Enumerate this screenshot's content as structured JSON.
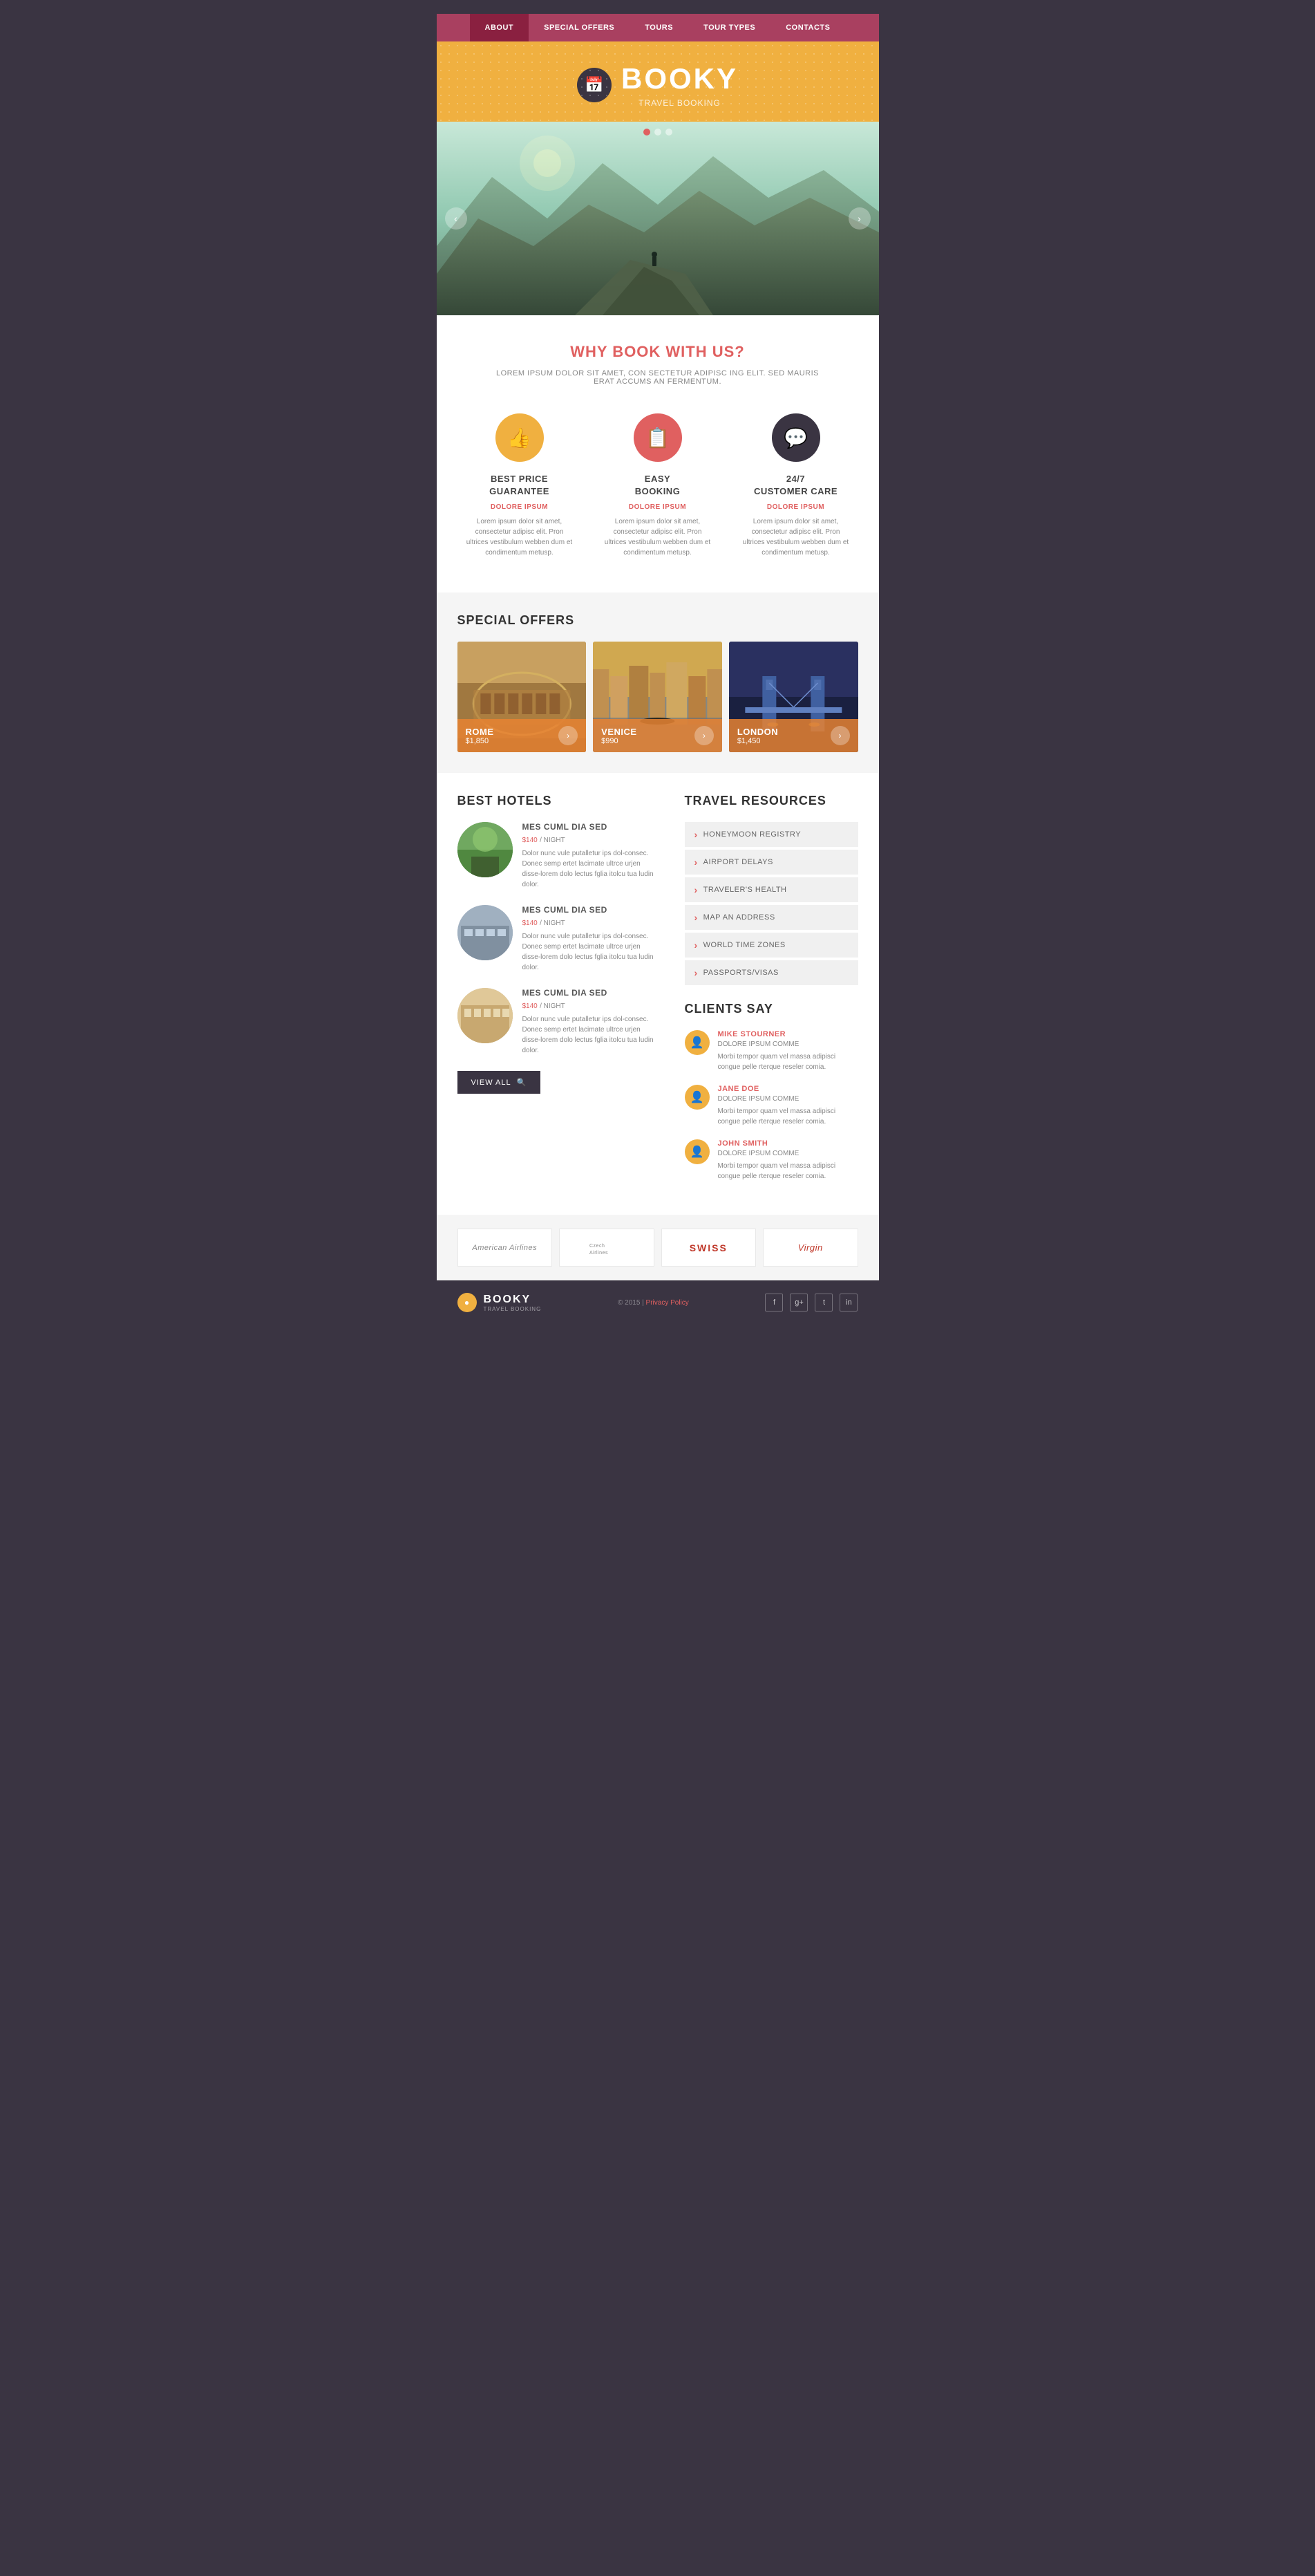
{
  "nav": {
    "items": [
      {
        "label": "ABOUT",
        "active": true
      },
      {
        "label": "SPECIAL OFFERS",
        "active": false
      },
      {
        "label": "TOURS",
        "active": false
      },
      {
        "label": "TOUR TYPES",
        "active": false
      },
      {
        "label": "CONTACTS",
        "active": false
      }
    ]
  },
  "header": {
    "icon": "📅",
    "title": "BOOKY",
    "subtitle": "TRAVEL BOOKING"
  },
  "hero": {
    "dots": [
      true,
      false,
      false
    ],
    "prev_arrow": "‹",
    "next_arrow": "›"
  },
  "why_book": {
    "title": "WHY BOOK WITH US?",
    "subtitle": "LOREM IPSUM DOLOR SIT AMET, CON SECTETUR ADIPISC ING ELIT. SED MAURIS ERAT ACCUMS AN FERMENTUM.",
    "features": [
      {
        "icon": "👍",
        "icon_class": "gold",
        "title": "BEST PRICE\nGUARANTEE",
        "subtitle": "DOLORE IPSUM",
        "desc": "Lorem ipsum dolor sit amet, consectetur adipisc elit. Pron ultrices vestibulum webben dum et condimentum metusp."
      },
      {
        "icon": "📋",
        "icon_class": "red",
        "title": "EASY\nBOOKING",
        "subtitle": "DOLORE IPSUM",
        "desc": "Lorem ipsum dolor sit amet, consectetur adipisc elit. Pron ultrices vestibulum webben dum et condimentum metusp."
      },
      {
        "icon": "💬",
        "icon_class": "dark",
        "title": "24/7\nCUSTOMER CARE",
        "subtitle": "DOLORE IPSUM",
        "desc": "Lorem ipsum dolor sit amet, consectetur adipisc elit. Pron ultrices vestibulum webben dum et condimentum metusp."
      }
    ]
  },
  "special_offers": {
    "section_title": "SPECIAL OFFERS",
    "offers": [
      {
        "name": "ROME",
        "price": "$1,850",
        "bg_class": "offer-rome-bg"
      },
      {
        "name": "VENICE",
        "price": "$990",
        "bg_class": "offer-venice-bg"
      },
      {
        "name": "LONDON",
        "price": "$1,450",
        "bg_class": "offer-london-bg"
      }
    ]
  },
  "best_hotels": {
    "section_title": "BEST HOTELS",
    "hotels": [
      {
        "name": "MES CUML DIA SED",
        "price": "$140",
        "price_suffix": "/ NIGHT",
        "desc": "Dolor nunc vule putalletur ips dol-consec. Donec semp ertet lacimate ultrce urjen disse-lorem dolo lectus fglia itolcu tua ludin dolor.",
        "img_class": "hotel-img-1"
      },
      {
        "name": "MES CUML DIA SED",
        "price": "$140",
        "price_suffix": "/ NIGHT",
        "desc": "Dolor nunc vule putalletur ips dol-consec. Donec semp ertet lacimate ultrce urjen disse-lorem dolo lectus fglia itolcu tua ludin dolor.",
        "img_class": "hotel-img-2"
      },
      {
        "name": "MES CUML DIA SED",
        "price": "$140",
        "price_suffix": "/ NIGHT",
        "desc": "Dolor nunc vule putalletur ips dol-consec. Donec semp ertet lacimate ultrce urjen disse-lorem dolo lectus fglia itolcu tua ludin dolor.",
        "img_class": "hotel-img-3"
      }
    ],
    "view_all_label": "VIEW ALL"
  },
  "travel_resources": {
    "section_title": "TRAVEL RESOURCES",
    "items": [
      "HONEYMOON REGISTRY",
      "AIRPORT DELAYS",
      "TRAVELER'S HEALTH",
      "MAP AN ADDRESS",
      "WORLD TIME ZONES",
      "PASSPORTS/VISAS"
    ]
  },
  "clients_say": {
    "section_title": "CLIENTS SAY",
    "clients": [
      {
        "name": "MIKE STOURNER",
        "role": "DOLORE IPSUM COMME",
        "text": "Morbi tempor quam vel massa adipisci congue pelle rterque reseler comia."
      },
      {
        "name": "JANE DOE",
        "role": "DOLORE IPSUM COMME",
        "text": "Morbi tempor quam vel massa adipisci congue pelle rterque reseler comia."
      },
      {
        "name": "JOHN SMITH",
        "role": "DOLORE IPSUM COMME",
        "text": "Morbi tempor quam vel massa adipisci congue pelle rterque reseler comia."
      }
    ]
  },
  "partners": {
    "logos": [
      "American Airlines",
      "Czech Airlines",
      "SWISS",
      "Virgin"
    ]
  },
  "footer": {
    "logo_icon": "●",
    "title": "BOOKY",
    "subtitle": "TRAVEL BOOKING",
    "copyright": "© 2015 |",
    "privacy_link": "Privacy Policy",
    "social": [
      "f",
      "g+",
      "t",
      "in"
    ]
  }
}
